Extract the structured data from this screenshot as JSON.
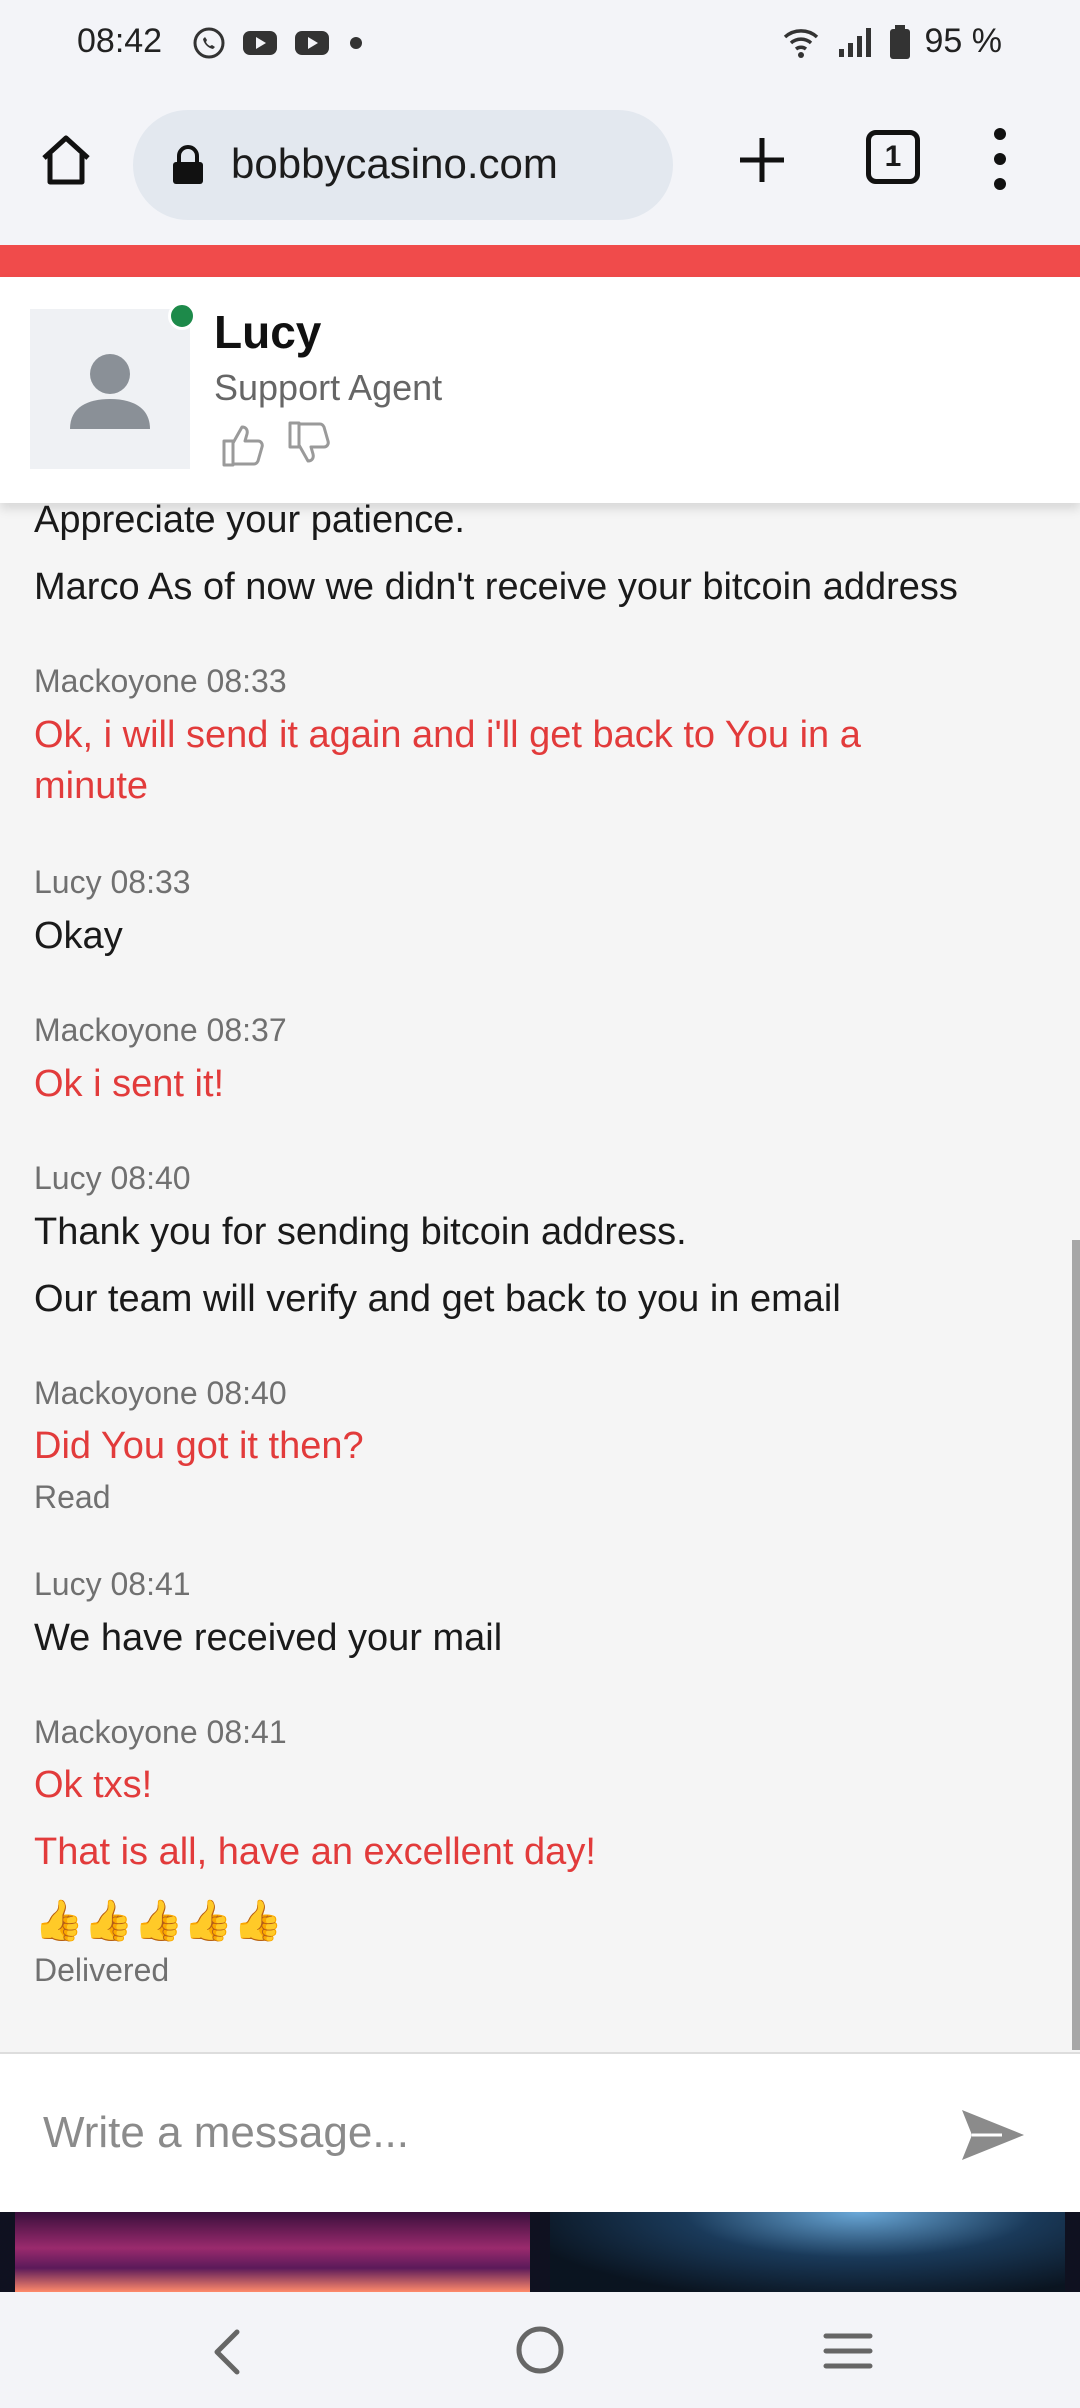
{
  "status_bar": {
    "time": "08:42",
    "battery": "95 %",
    "icons": [
      "whatsapp-icon",
      "youtube-icon",
      "youtube-icon",
      "dot-icon",
      "wifi-icon",
      "signal-icon",
      "battery-icon"
    ]
  },
  "browser": {
    "url": "bobbycasino.com",
    "tab_count": "1"
  },
  "agent": {
    "name": "Lucy",
    "role": "Support Agent",
    "status_color": "#1d8a4a"
  },
  "chat": {
    "lines": [
      {
        "kind": "agent",
        "text": "Appreciate your patience."
      },
      {
        "kind": "agent",
        "text": "Marco As of now we didn't receive your bitcoin address"
      },
      {
        "kind": "meta",
        "text": "Mackoyone 08:33"
      },
      {
        "kind": "user",
        "text": "Ok, i will send it again and i'll get back to You in a"
      },
      {
        "kind": "user",
        "text": "minute"
      },
      {
        "kind": "meta",
        "text": "Lucy 08:33"
      },
      {
        "kind": "agent",
        "text": "Okay"
      },
      {
        "kind": "meta",
        "text": "Mackoyone 08:37"
      },
      {
        "kind": "user",
        "text": "Ok i sent it!"
      },
      {
        "kind": "meta",
        "text": "Lucy 08:40"
      },
      {
        "kind": "agent",
        "text": "Thank you for sending bitcoin address."
      },
      {
        "kind": "agent",
        "text": "Our team will verify and get back to you in email"
      },
      {
        "kind": "meta",
        "text": "Mackoyone 08:40"
      },
      {
        "kind": "user",
        "text": "Did You got it then?"
      },
      {
        "kind": "meta",
        "text": "Read"
      },
      {
        "kind": "meta",
        "text": "Lucy 08:41"
      },
      {
        "kind": "agent",
        "text": "We have received your mail"
      },
      {
        "kind": "meta",
        "text": "Mackoyone 08:41"
      },
      {
        "kind": "user",
        "text": "Ok txs!"
      },
      {
        "kind": "user",
        "text": "That is all, have an excellent day!"
      },
      {
        "kind": "emoji",
        "text": "👍👍👍👍👍"
      },
      {
        "kind": "meta",
        "text": "Delivered"
      }
    ]
  },
  "composer": {
    "placeholder": "Write a message..."
  },
  "colors": {
    "accent_red": "#f04b4b",
    "user_text": "#e23b3b"
  }
}
